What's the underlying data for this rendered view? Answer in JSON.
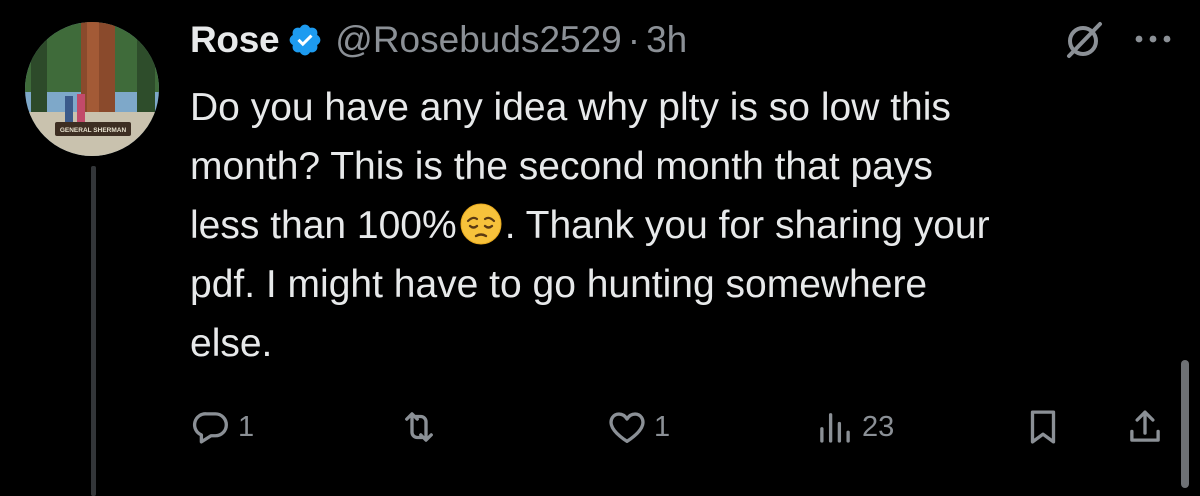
{
  "author": {
    "name": "Rose",
    "handle": "@Rosebuds2529",
    "separator": "·",
    "time": "3h",
    "avatar_icon": "avatar-icon",
    "avatar_sign_text": "GENERAL SHERMAN",
    "verified_icon": "verified-badge-icon"
  },
  "tweet": {
    "lines": [
      "Do you have any idea why plty is so low this",
      "month? This is the second month that pays",
      "less than 100%",
      ". Thank you for sharing your",
      "pdf. I might have to go hunting somewhere",
      "else."
    ],
    "emoji": "pensive-face-emoji"
  },
  "actions": {
    "reply_count": "1",
    "retweet_count": "",
    "like_count": "1",
    "views_count": "23"
  },
  "colors": {
    "background": "#000000",
    "text": "#e7e9ea",
    "secondary": "#8b9096",
    "verified": "#1d9bf0"
  }
}
